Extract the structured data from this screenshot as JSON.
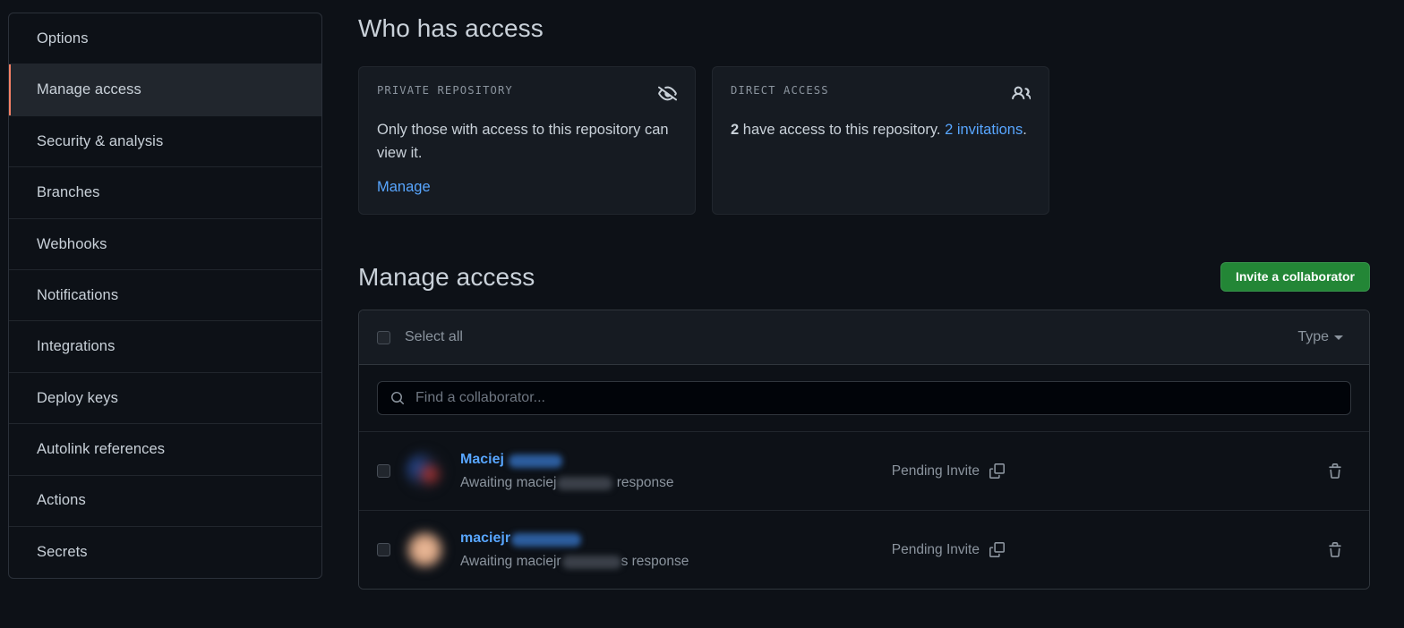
{
  "sidebar": {
    "items": [
      {
        "label": "Options",
        "selected": false
      },
      {
        "label": "Manage access",
        "selected": true
      },
      {
        "label": "Security & analysis",
        "selected": false
      },
      {
        "label": "Branches",
        "selected": false
      },
      {
        "label": "Webhooks",
        "selected": false
      },
      {
        "label": "Notifications",
        "selected": false
      },
      {
        "label": "Integrations",
        "selected": false
      },
      {
        "label": "Deploy keys",
        "selected": false
      },
      {
        "label": "Autolink references",
        "selected": false
      },
      {
        "label": "Actions",
        "selected": false
      },
      {
        "label": "Secrets",
        "selected": false
      }
    ]
  },
  "who_has_access": {
    "title": "Who has access",
    "cards": [
      {
        "label": "PRIVATE REPOSITORY",
        "icon": "eye-slash-icon",
        "body": "Only those with access to this repository can view it.",
        "action_label": "Manage"
      },
      {
        "label": "DIRECT ACCESS",
        "icon": "people-icon",
        "count": "2",
        "body_text": " have access to this repository. ",
        "invitations_link": "2 invitations",
        "body_suffix": "."
      }
    ]
  },
  "manage_access": {
    "title": "Manage access",
    "invite_button": "Invite a collaborator",
    "select_all_label": "Select all",
    "type_filter_label": "Type",
    "search_placeholder": "Find a collaborator...",
    "search_value": "",
    "collaborators": [
      {
        "name_visible": "Maciej ",
        "name_redacted_width": 60,
        "sub_prefix": "Awaiting maciej",
        "sub_redacted_width": 62,
        "sub_suffix": " response",
        "status": "Pending Invite",
        "status_icon": "clipboard-icon",
        "delete_icon": "trash-icon",
        "avatar_style": "a1"
      },
      {
        "name_visible": "maciejr",
        "name_redacted_width": 78,
        "sub_prefix": "Awaiting maciejr",
        "sub_redacted_width": 66,
        "sub_suffix": "s response",
        "status": "Pending Invite",
        "status_icon": "clipboard-icon",
        "delete_icon": "trash-icon",
        "avatar_style": "a2"
      }
    ]
  },
  "colors": {
    "page_bg": "#0d1117",
    "card_bg": "#161b22",
    "border": "#30363d",
    "link": "#58a6ff",
    "accent_bar": "#f78166",
    "green_button": "#238636",
    "muted_text": "#8b949e",
    "text": "#c9d1d9"
  }
}
